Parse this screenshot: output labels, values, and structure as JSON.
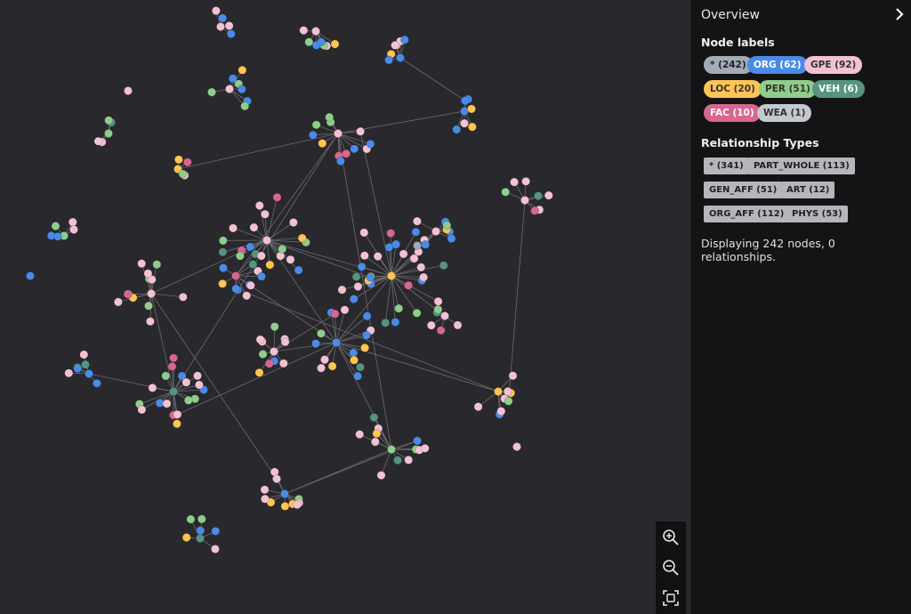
{
  "panel": {
    "title": "Overview",
    "collapse_icon": "chevron-right-icon",
    "node_labels_heading": "Node labels",
    "node_labels": [
      {
        "label": "* (242)",
        "bg": "#a5abb6",
        "fg": "#222222"
      },
      {
        "label": "ORG (62)",
        "bg": "#4a8be8",
        "fg": "#ffffff"
      },
      {
        "label": "GPE (92)",
        "bg": "#f2c2d4",
        "fg": "#333333"
      },
      {
        "label": "LOC (20)",
        "bg": "#ffc454",
        "fg": "#333333"
      },
      {
        "label": "PER (51)",
        "bg": "#8fce8a",
        "fg": "#333333"
      },
      {
        "label": "VEH (6)",
        "bg": "#569480",
        "fg": "#ffffff"
      },
      {
        "label": "FAC (10)",
        "bg": "#d9668f",
        "fg": "#ffffff"
      },
      {
        "label": "WEA (1)",
        "bg": "#c4c8cf",
        "fg": "#333333"
      }
    ],
    "rel_types_heading": "Relationship Types",
    "rel_types": [
      "* (341)",
      "PART_WHOLE (113)",
      "GEN_AFF (51)",
      "ART (12)",
      "ORG_AFF (112)",
      "PHYS (53)"
    ],
    "status": "Displaying 242 nodes, 0 relationships."
  },
  "zoom": {
    "zoom_in_icon": "zoom-in-icon",
    "zoom_out_icon": "zoom-out-icon",
    "fit_icon": "fit-to-screen-icon"
  },
  "graph": {
    "colors": {
      "ORG": "#4a8be8",
      "GPE": "#f2c2d4",
      "LOC": "#ffc454",
      "PER": "#8fce8a",
      "VEH": "#569480",
      "FAC": "#d9668f",
      "WEA": "#a5abb6"
    },
    "edge_color": "#6a6a70"
  }
}
